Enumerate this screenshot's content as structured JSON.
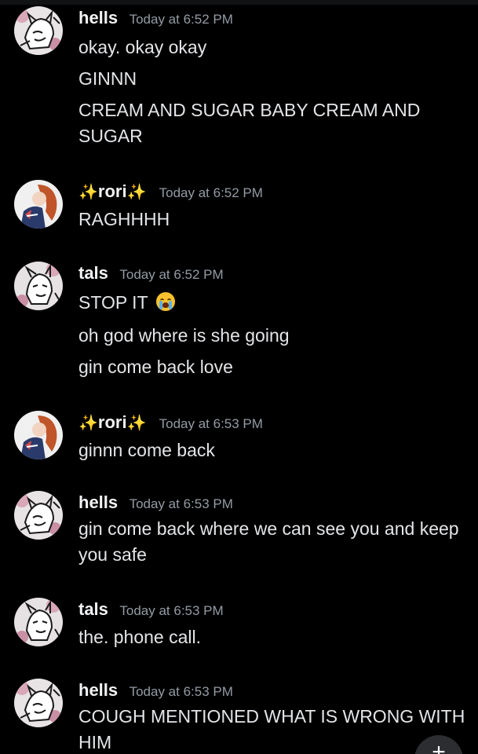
{
  "messages": [
    {
      "author": "hells",
      "author_style": "plain",
      "avatar": "hells-avatar",
      "timestamp": "Today at 6:52 PM",
      "lines": [
        "okay. okay okay",
        "GINNN",
        "CREAM AND SUGAR BABY CREAM AND SUGAR"
      ]
    },
    {
      "author": "rori",
      "author_style": "sparkles",
      "avatar": "rori-avatar",
      "timestamp": "Today at 6:52 PM",
      "lines": [
        "RAGHHHH"
      ]
    },
    {
      "author": "tals",
      "author_style": "plain",
      "avatar": "tals-avatar",
      "timestamp": "Today at 6:52 PM",
      "lines": [
        "STOP IT",
        "oh god where is she going",
        "gin come back love"
      ],
      "line_emojis": [
        "loudly-crying-face-emoji",
        "",
        ""
      ]
    },
    {
      "author": "rori",
      "author_style": "sparkles",
      "avatar": "rori-avatar",
      "timestamp": "Today at 6:53 PM",
      "lines": [
        "ginnn come back"
      ]
    },
    {
      "author": "hells",
      "author_style": "plain",
      "avatar": "hells-avatar",
      "timestamp": "Today at 6:53 PM",
      "lines": [
        "gin come back where we can see you and keep you safe"
      ]
    },
    {
      "author": "tals",
      "author_style": "plain",
      "avatar": "tals-avatar",
      "timestamp": "Today at 6:53 PM",
      "lines": [
        "the. phone call."
      ]
    },
    {
      "author": "hells",
      "author_style": "plain",
      "avatar": "hells-avatar",
      "timestamp": "Today at 6:53 PM",
      "lines": [
        "COUGH MENTIONED WHAT IS WRONG WITH HIM"
      ]
    }
  ],
  "sparkle_glyph": "✨",
  "fab": {
    "icon": "plus-icon",
    "label": "+"
  },
  "colors": {
    "background": "#000000",
    "author": "#f2f3f5",
    "timestamp": "#949ba4",
    "text": "#e3e5e8",
    "sparkle": "#f5c542"
  }
}
